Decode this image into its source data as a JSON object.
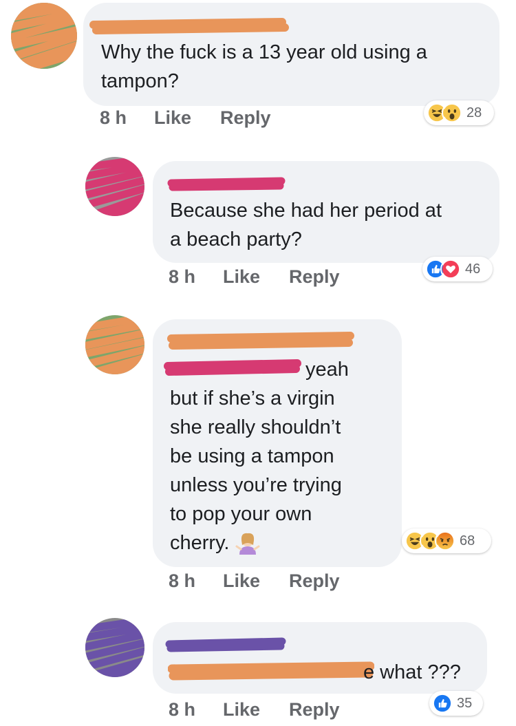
{
  "comments": [
    {
      "lines": [
        "Why the fuck is a 13 year old using a",
        "tampon?"
      ],
      "time": "8 h",
      "like": "Like",
      "reply": "Reply",
      "reactions": [
        "haha-icon",
        "wow-icon"
      ],
      "reaction_count": "28"
    },
    {
      "lines": [
        "Because she had her period at",
        "a beach party?"
      ],
      "time": "8 h",
      "like": "Like",
      "reply": "Reply",
      "reactions": [
        "like-icon",
        "love-icon"
      ],
      "reaction_count": "46"
    },
    {
      "tag_suffix": "yeah",
      "lines": [
        "but if she’s a virgin",
        "she really shouldn’t",
        "be using a tampon",
        "unless you’re trying",
        "to pop your own",
        "cherry."
      ],
      "emoji": "woman-shrugging-icon",
      "time": "8 h",
      "like": "Like",
      "reply": "Reply",
      "reactions": [
        "haha-icon",
        "wow-icon",
        "angry-icon"
      ],
      "reaction_count": "68"
    },
    {
      "tag_suffix": "e what ???",
      "time": "8 h",
      "like": "Like",
      "reply": "Reply",
      "reactions": [
        "like-icon"
      ],
      "reaction_count": "35"
    }
  ],
  "colors": {
    "bubble": "#f0f2f5",
    "meta_text": "#65676b",
    "redact_orange": "#e8955a",
    "redact_pink": "#d63a72",
    "redact_purple": "#6a52a8"
  }
}
